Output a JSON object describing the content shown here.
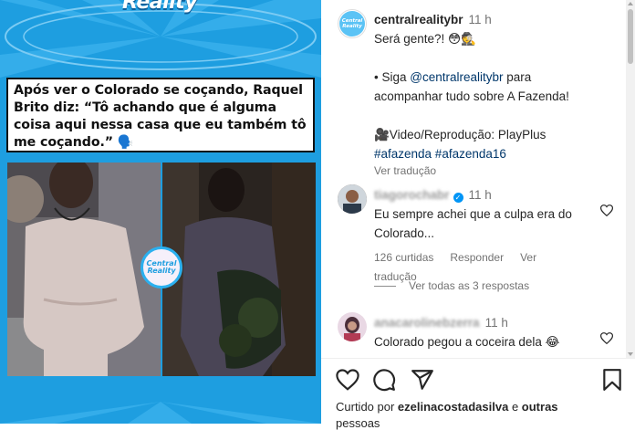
{
  "media": {
    "logo_text": "Reality",
    "headline": "Após ver o Colorado se coçando, Raquel Brito diz: “Tô achando que é alguma coisa aqui nessa casa que eu também tô me coçando.” 🗣️",
    "badge_text": "Central Reality",
    "colors": {
      "background": "#1e9ee0",
      "accent": "#2bb0ef"
    }
  },
  "post": {
    "avatar_text": "Central Reality",
    "username": "centralrealitybr",
    "time": "11 h",
    "caption_lines": [
      "Será gente?! 😳🕵️",
      "",
      "• Siga ",
      "acompanhar tudo sobre A Fazenda!",
      "",
      "🎥Video/Reprodução: PlayPlus"
    ],
    "mention": "@centralrealitybr",
    "mention_suffix": " para",
    "hashtags": "#afazenda #afazenda16",
    "translate": "Ver tradução"
  },
  "comments": [
    {
      "username": "tiagorochabr",
      "verified": true,
      "time": "11 h",
      "text": "Eu sempre achei que a culpa era do Colorado...",
      "likes": "126 curtidas",
      "reply": "Responder",
      "translate": "Ver tradução"
    },
    {
      "username": "anacarolinebzerra",
      "verified": false,
      "time": "11 h",
      "text": "Colorado pegou a coceira dela 😂"
    }
  ],
  "replies_label": "Ver todas as 3 respostas",
  "footer": {
    "liked_by_prefix": "Curtido por ",
    "liked_by_user": "ezelinacostadasilva",
    "liked_by_suffix": " e ",
    "liked_by_others": "outras",
    "second_line": "pessoas"
  },
  "icons": [
    "heart-icon",
    "comment-icon",
    "share-icon",
    "bookmark-icon"
  ]
}
